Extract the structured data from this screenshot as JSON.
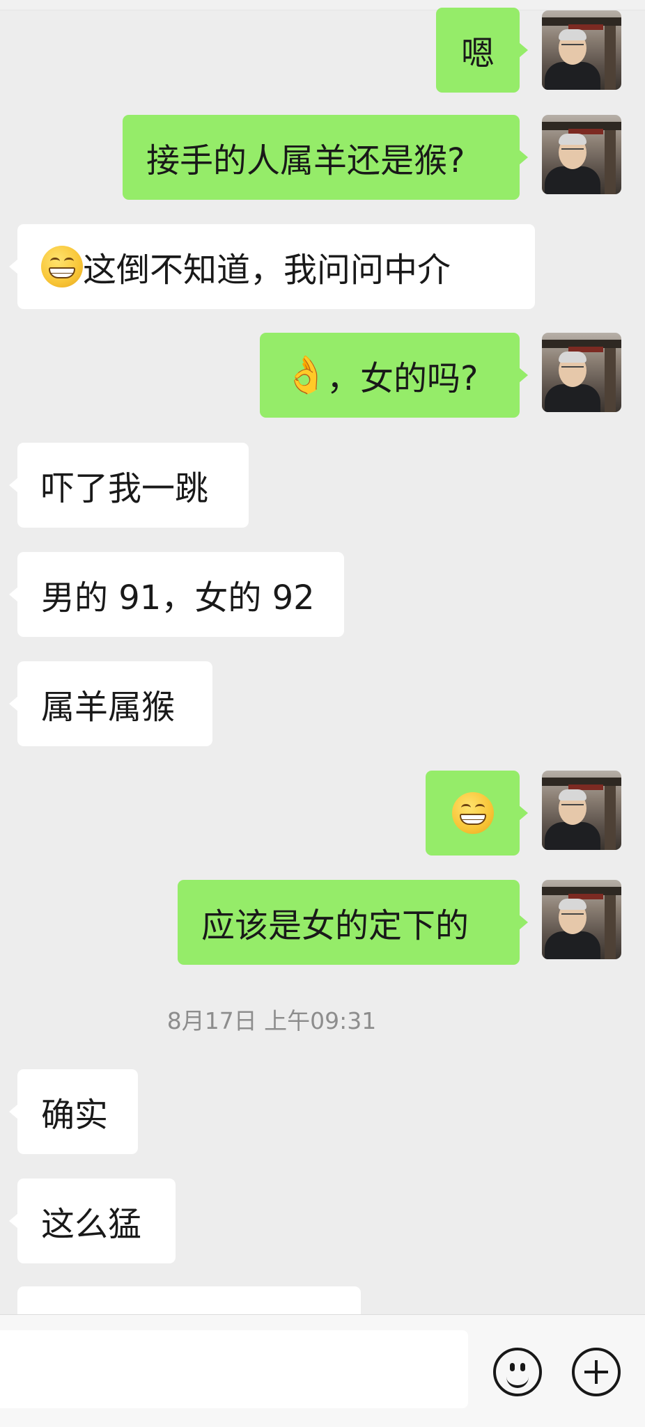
{
  "messages": [
    {
      "side": "out",
      "text": "嗯"
    },
    {
      "side": "out",
      "text": "接手的人属羊还是猴?"
    },
    {
      "side": "in",
      "emoji": "grin-emoji",
      "text": "这倒不知道，我问问中介"
    },
    {
      "side": "out",
      "emoji": "ok-hand-emoji",
      "text": "，女的吗?"
    },
    {
      "side": "in",
      "text": "吓了我一跳"
    },
    {
      "side": "in",
      "text": "男的 91，女的 92"
    },
    {
      "side": "in",
      "text": "属羊属猴"
    },
    {
      "side": "out",
      "emoji": "grin-emoji",
      "text": ""
    },
    {
      "side": "out",
      "text": "应该是女的定下的"
    },
    {
      "side": "timestamp",
      "text": "8月17日 上午09:31"
    },
    {
      "side": "in",
      "text": "确实"
    },
    {
      "side": "in",
      "text": "这么猛"
    }
  ],
  "input_bar": {
    "text_value": "",
    "emoji_button_icon": "smiley-icon",
    "more_button_icon": "plus-circle-icon"
  },
  "colors": {
    "background": "#ededed",
    "outgoing_bubble": "#95ec69",
    "incoming_bubble": "#ffffff",
    "timestamp_text": "#8d8d8d"
  }
}
